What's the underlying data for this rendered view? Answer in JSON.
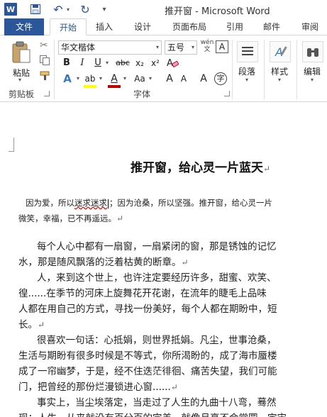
{
  "titlebar": {
    "app_logo": "W",
    "title": "推开窗 - Microsoft Word",
    "icons": [
      "word-logo",
      "save-icon",
      "undo-icon",
      "redo-icon",
      "quick-access-dropdown"
    ]
  },
  "tabs": {
    "file": "文件",
    "home": "开始",
    "insert": "插入",
    "design": "设计",
    "layout": "页面布局",
    "references": "引用",
    "mailings": "邮件",
    "review": "审阅"
  },
  "ribbon": {
    "clipboard": {
      "paste": "粘贴",
      "group": "剪贴板"
    },
    "font": {
      "name": "华文楷体",
      "size": "五号",
      "phonetic": "wén\n文",
      "char_border": "A",
      "bold": "B",
      "italic": "I",
      "underline": "U",
      "strike": "abc",
      "subscript": "x₂",
      "superscript": "x²",
      "text_effect": "A",
      "highlight": "ab",
      "font_color": "A",
      "change_case": "Aa",
      "grow": "A",
      "shrink": "A",
      "enclose": "字",
      "char_shading": "A",
      "group": "字体"
    },
    "paragraph": {
      "label": "段落"
    },
    "styles": {
      "label": "样式"
    },
    "editing": {
      "label": "编辑"
    }
  },
  "accent_colors": {
    "word_blue": "#2b579a",
    "highlight": "#ffff00",
    "font_color": "#c00000"
  },
  "document": {
    "title": "推开窗，给心灵一片蓝天",
    "lines": [
      {
        "pre": "因为爱，所以",
        "err": "迷求迷求",
        "post": "；因为沧桑，所以坚强。推开窗，给心灵一片"
      },
      {
        "text": "微笑，幸福，已不再遥远。"
      },
      {
        "text": "每个人心中都有一扇窗，一扇紧闭的窗，那是锈蚀的记忆"
      },
      {
        "text": "水，那是随风飘落的泛着枯黄的断章。"
      },
      {
        "text": "人，来到这个世上，也许注定要经历许多，甜蜜、欢笑、"
      },
      {
        "text": "徨......在季节的河床上旋舞花开花谢，在流年的睫毛上品味"
      },
      {
        "text": "人都在用自己的方式，寻找一份美好，每个人都在期盼中，短"
      },
      {
        "text": "长。"
      },
      {
        "text": "很喜欢一句话：心抵娟，则世界抵娟。凡尘，世事沧桑，"
      },
      {
        "text": "生活与期盼有很多时候是不等式，你所渴盼的，成了海市蜃楼"
      },
      {
        "text": "成了一帘幽梦，于是，经不住迭茫徘徊、痛苦失望，我们可能"
      },
      {
        "text": "门，把曾经的那份烂漫锁进心窗......"
      },
      {
        "text": "事实上，当尘埃落定，当走过了人生的九曲十八弯，蓦然"
      },
      {
        "text": "现：人生，从来就没有百分百的完美，就像月亮不会常圆，宇宙"
      }
    ]
  }
}
